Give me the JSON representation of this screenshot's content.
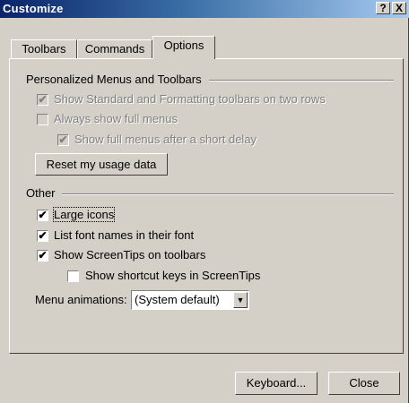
{
  "window": {
    "title": "Customize",
    "help_glyph": "?",
    "close_glyph": "X"
  },
  "tabs": [
    {
      "label": "Toolbars"
    },
    {
      "label": "Commands"
    },
    {
      "label": "Options"
    }
  ],
  "sections": {
    "personalized": {
      "title": "Personalized Menus and Toolbars"
    },
    "other": {
      "title": "Other"
    }
  },
  "options": {
    "two_rows": {
      "label": "Show Standard and Formatting toolbars on two rows",
      "checked": true,
      "enabled": false
    },
    "full_menus": {
      "label": "Always show full menus",
      "checked": false,
      "enabled": false
    },
    "delay": {
      "label": "Show full menus after a short delay",
      "checked": true,
      "enabled": false
    },
    "reset_label": "Reset my usage data",
    "large_icons": {
      "label": "Large icons",
      "checked": true
    },
    "font_names": {
      "label": "List font names in their font",
      "checked": true
    },
    "screentips": {
      "label": "Show ScreenTips on toolbars",
      "checked": true
    },
    "shortcut_keys": {
      "label": "Show shortcut keys in ScreenTips",
      "checked": false
    },
    "menu_animations": {
      "label": "Menu animations:",
      "value": "(System default)"
    }
  },
  "footer": {
    "keyboard_label": "Keyboard...",
    "close_label": "Close"
  },
  "check_glyph": "✔",
  "icons": {
    "dropdown": "chevron-down-icon",
    "help": "help-icon",
    "close": "close-icon"
  },
  "colors": {
    "title_start": "#0a246a",
    "title_end": "#a6caf0",
    "face": "#d4d0c8"
  }
}
